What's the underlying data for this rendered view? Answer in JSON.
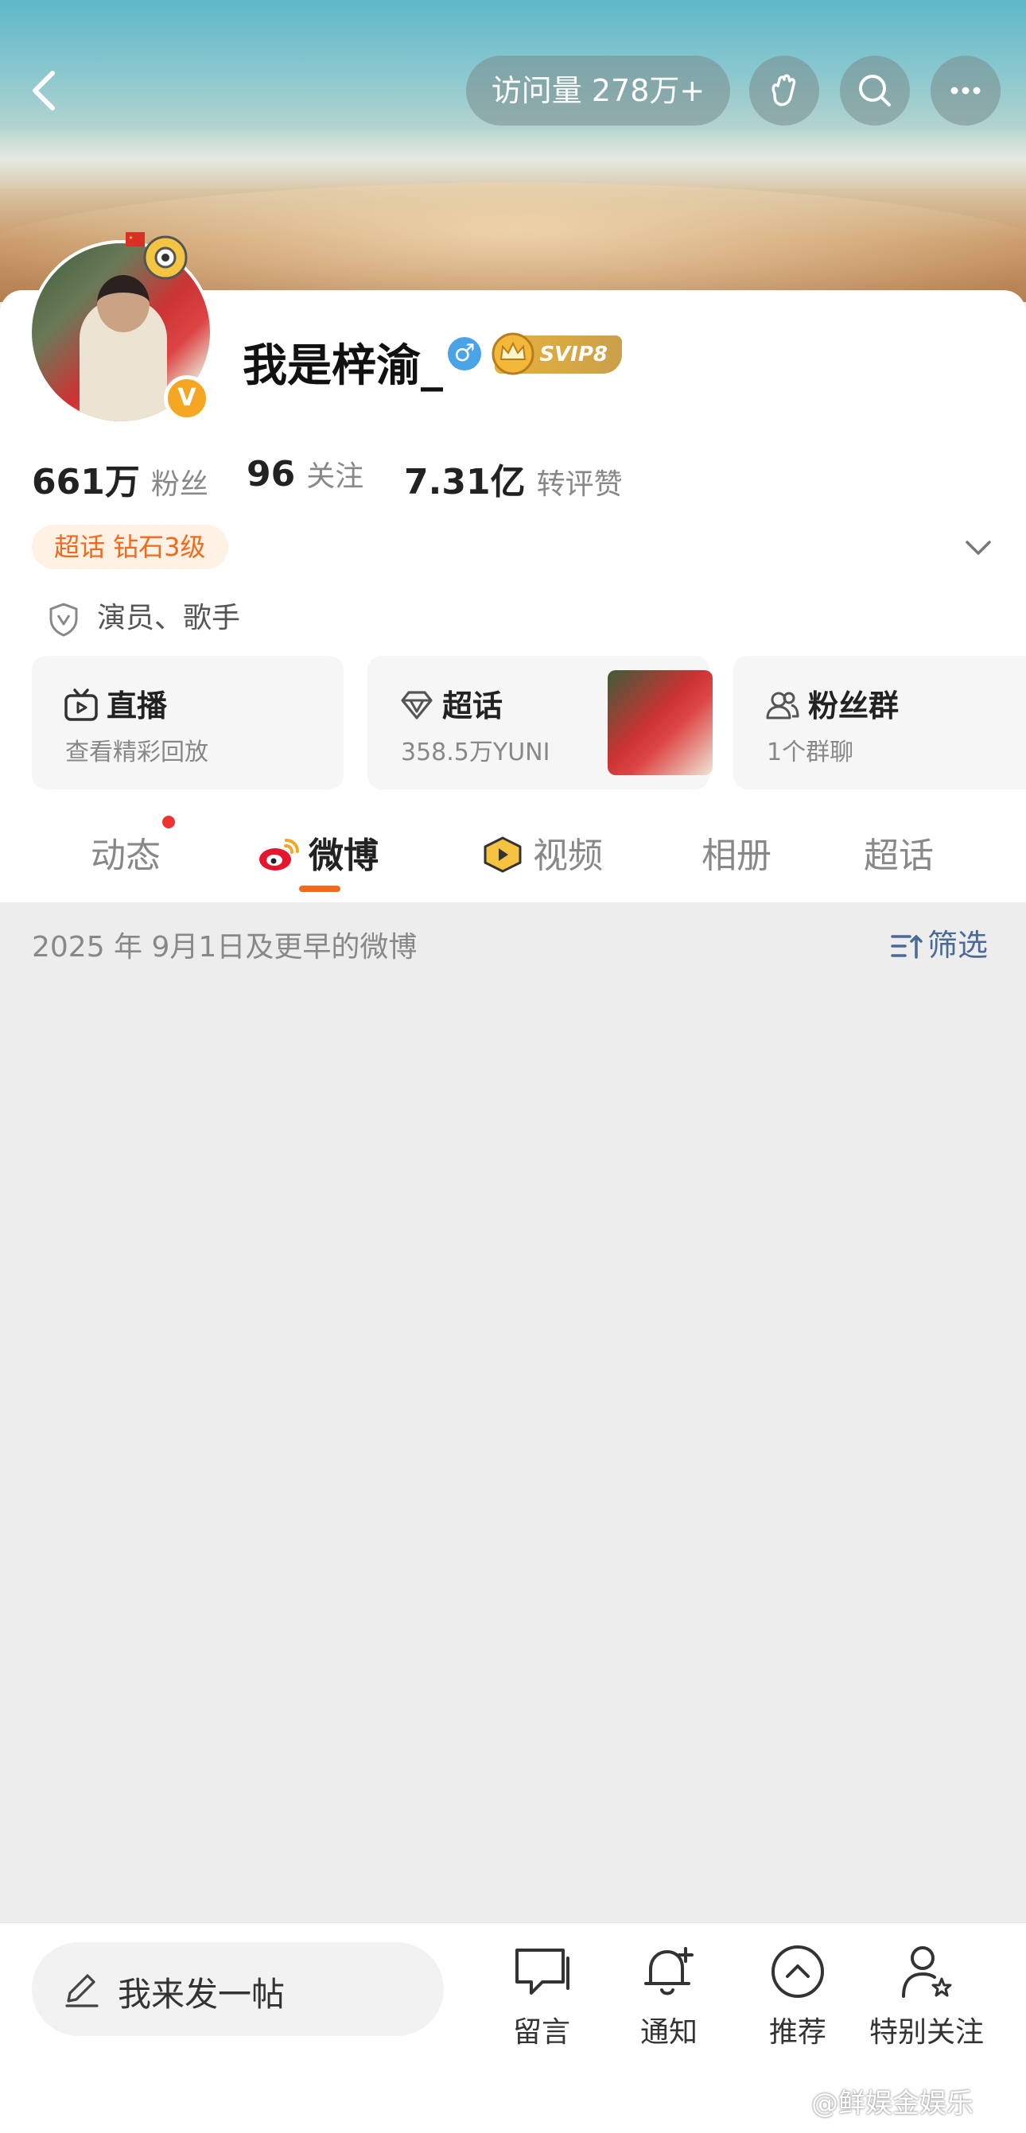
{
  "header": {
    "visits_label": "访问量 278万+"
  },
  "profile": {
    "name": "我是梓渝_",
    "gender_symbol": "♂",
    "vip_label": "SVIP8",
    "verified_symbol": "V",
    "stats": [
      {
        "value": "661万",
        "label": "粉丝"
      },
      {
        "value": "96",
        "label": "关注"
      },
      {
        "value": "7.31亿",
        "label": "转评赞"
      }
    ],
    "supertopic_tag": "超话 钻石3级",
    "occupation": "演员、歌手"
  },
  "features": [
    {
      "title": "直播",
      "subtitle": "查看精彩回放",
      "icon": "tv-icon"
    },
    {
      "title": "超话",
      "subtitle": "358.5万YUNI",
      "icon": "diamond-icon"
    },
    {
      "title": "粉丝群",
      "subtitle": "1个群聊",
      "icon": "people-icon"
    }
  ],
  "tabs": [
    {
      "label": "动态",
      "has_dot": true
    },
    {
      "label": "微博",
      "active": true,
      "icon": "weibo-icon"
    },
    {
      "label": "视频",
      "icon": "video-badge-icon"
    },
    {
      "label": "相册"
    },
    {
      "label": "超话"
    }
  ],
  "filter": {
    "date_text": "2025 年 9月1日及更早的微博",
    "filter_label": "筛选"
  },
  "bottom_bar": {
    "compose_placeholder": "我来发一帖",
    "actions": [
      {
        "label": "留言",
        "icon": "message-icon"
      },
      {
        "label": "通知",
        "icon": "bell-plus-icon"
      },
      {
        "label": "推荐",
        "icon": "chevron-up-circle-icon"
      },
      {
        "label": "特别关注",
        "icon": "user-star-icon"
      }
    ]
  },
  "watermark": "@鲜娱金娱乐",
  "colors": {
    "accent": "#f06a1e",
    "filter_blue": "#4b6a95",
    "dot_red": "#ee3333",
    "gender_blue": "#4aa3e6"
  }
}
